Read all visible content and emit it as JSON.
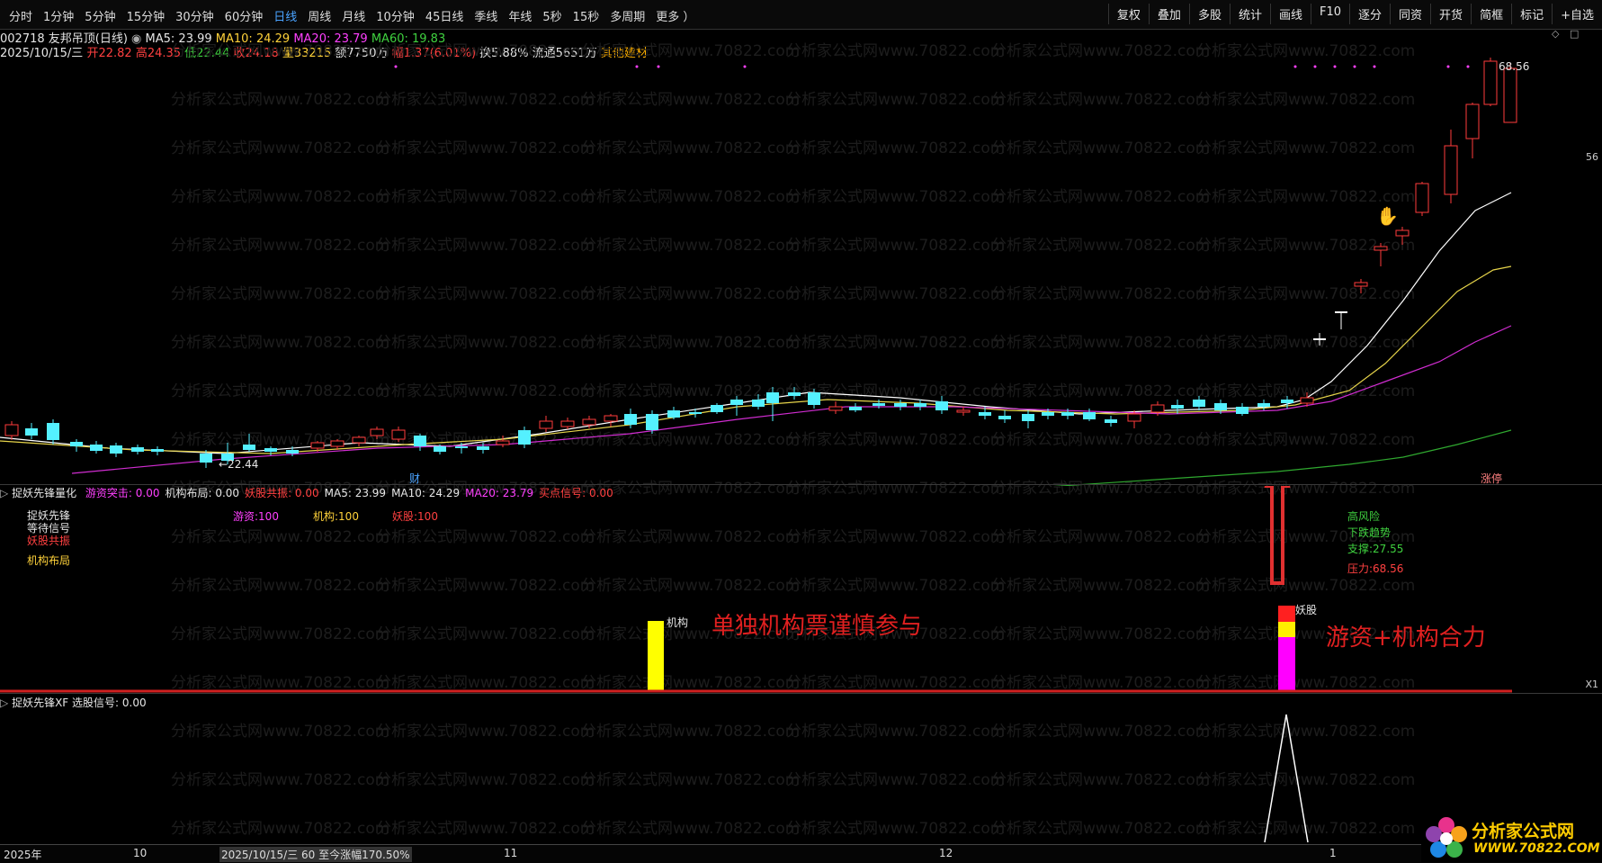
{
  "toolbar": {
    "periods": [
      "分时",
      "1分钟",
      "5分钟",
      "15分钟",
      "30分钟",
      "60分钟",
      "日线",
      "周线",
      "月线",
      "10分钟",
      "45日线",
      "季线",
      "年线",
      "5秒",
      "15秒",
      "多周期",
      "更多 ）"
    ],
    "active_period": "日线",
    "tools": [
      "复权",
      "叠加",
      "多股",
      "统计",
      "画线",
      "F10",
      "逐分",
      "同资",
      "开货",
      "简框",
      "标记",
      "+自选"
    ]
  },
  "info1": {
    "code_name": "002718 友邦吊顶(日线)",
    "ma5": "MA5: 23.99",
    "ma10": "MA10: 24.29",
    "ma20": "MA20: 23.79",
    "ma60": "MA60: 19.83"
  },
  "info2": {
    "date": "2025/10/15/三",
    "open": "开22.82",
    "high": "高24.35",
    "low": "低22.44",
    "close": "收24.18",
    "vol": "量33215",
    "amount": "额7750万",
    "range": "幅1.37(6.01%)",
    "turnover": "换5.88%",
    "float": "流通5651万",
    "sector": "其他建材"
  },
  "main_chart": {
    "price_high_label": "68.56",
    "price_low_label": "←22.44",
    "scale_56": "56",
    "fin_marker": "财",
    "zt_marker": "涨停",
    "colors": {
      "up": "#ff3b3b",
      "down": "#54f0ff",
      "ma5": "#ffffff",
      "ma10": "#e5d34a",
      "ma20": "#d02cd0",
      "ma60": "#2fa82f"
    }
  },
  "indicator1": {
    "title": "捉妖先锋量化",
    "vals": [
      {
        "t": "游资突击: 0.00",
        "c": "#ff40ff"
      },
      {
        "t": "机构布局: 0.00",
        "c": "#e6e6e6"
      },
      {
        "t": "妖股共振: 0.00",
        "c": "#ff4040"
      },
      {
        "t": "MA5: 23.99",
        "c": "#e6e6e6"
      },
      {
        "t": "MA10: 24.29",
        "c": "#e6e6e6"
      },
      {
        "t": "MA20: 23.79",
        "c": "#ff40ff"
      },
      {
        "t": "买点信号: 0.00",
        "c": "#ff4040"
      }
    ],
    "legend": [
      "捉妖先锋",
      "等待信号",
      "妖股共振",
      "机构布局"
    ],
    "scores": [
      "游资:100",
      "机构:100",
      "妖股:100"
    ],
    "risk": {
      "high": "高风险",
      "trend": "下跌趋势",
      "support": "支撑:27.55",
      "pressure": "压力:68.56"
    },
    "bar1_label": "机构",
    "bar2_label": "妖股",
    "annotation1": "单独机构票谨慎参与",
    "annotation2": "游资+机构合力",
    "x1": "X1"
  },
  "indicator2": {
    "title": "捉妖先锋XF",
    "signal": "选股信号: 0.00"
  },
  "bottom": {
    "year": "2025年",
    "m10": "10",
    "cursor": "2025/10/15/三  60 至今涨幅170.50%",
    "m11": "11",
    "m12": "12",
    "m1": "1"
  },
  "watermark": "分析家公式网www.70822.com",
  "logo": {
    "name": "分析家公式网",
    "url": "WWW.70822.COM"
  }
}
